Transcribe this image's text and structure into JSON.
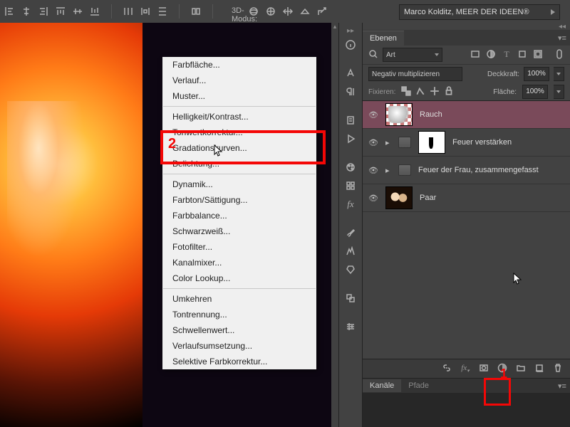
{
  "topbar": {
    "mode3d_label": "3D-Modus:",
    "workspace": "Marco Kolditz, MEER DER IDEEN®"
  },
  "panels": {
    "layers_tab": "Ebenen",
    "filter_kind": "Art",
    "search_icon": "search-icon",
    "blend_mode": "Negativ multiplizieren",
    "opacity_label": "Deckkraft:",
    "opacity_value": "100%",
    "lock_label": "Fixieren:",
    "fill_label": "Fläche:",
    "fill_value": "100%",
    "channels_tab": "Kanäle",
    "paths_tab": "Pfade"
  },
  "layers": [
    {
      "name": "Rauch",
      "selected": true,
      "type": "layer"
    },
    {
      "name": "Feuer verstärken",
      "type": "group"
    },
    {
      "name": "Feuer der Frau, zusammengefasst",
      "type": "group"
    },
    {
      "name": "Paar",
      "type": "layer"
    }
  ],
  "menu": {
    "s1": [
      "Farbfläche...",
      "Verlauf...",
      "Muster..."
    ],
    "s2": [
      "Helligkeit/Kontrast...",
      "Tonwertkorrektur...",
      "Gradationskurven...",
      "Belichtung..."
    ],
    "s3": [
      "Dynamik...",
      "Farbton/Sättigung...",
      "Farbbalance...",
      "Schwarzweiß...",
      "Fotofilter...",
      "Kanalmixer...",
      "Color Lookup..."
    ],
    "s4": [
      "Umkehren",
      "Tontrennung...",
      "Schwellenwert...",
      "Verlaufsumsetzung...",
      "Selektive Farbkorrektur..."
    ]
  },
  "callouts": {
    "one": "1",
    "two": "2"
  }
}
